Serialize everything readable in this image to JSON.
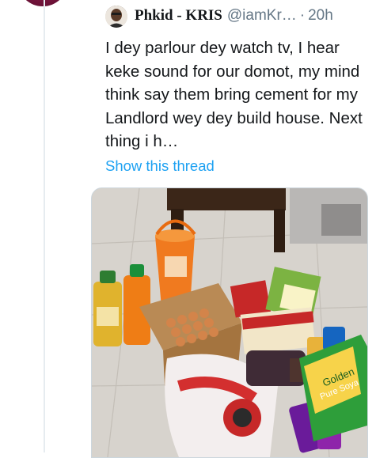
{
  "tweet": {
    "display_name": "Phkid - KRIS",
    "handle": "@iamKr…",
    "separator": "·",
    "time": "20h",
    "text": "I dey parlour dey watch tv, I hear keke sound for our domot, my mind think say them bring cement for my Landlord wey dey build house. Next thing i h…",
    "show_thread_label": "Show this thread",
    "link_color": "#1da1f2"
  },
  "media": {
    "product_labels": [
      "Golden",
      "Pure Soya"
    ]
  },
  "icons": {
    "previous_avatar": "profile-avatar-icon",
    "author_avatar": "user-avatar-icon"
  }
}
